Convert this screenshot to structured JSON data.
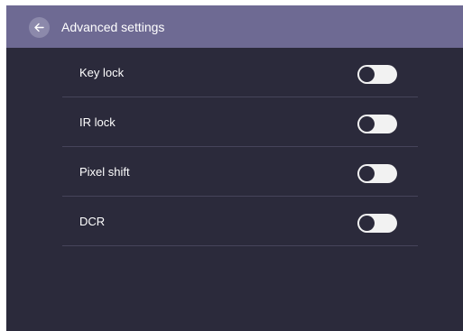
{
  "header": {
    "back_icon": "arrow-left-icon",
    "title": "Advanced settings"
  },
  "settings": {
    "items": [
      {
        "label": "Key lock",
        "enabled": false
      },
      {
        "label": "IR lock",
        "enabled": false
      },
      {
        "label": "Pixel shift",
        "enabled": false
      },
      {
        "label": "DCR",
        "enabled": false
      }
    ]
  },
  "colors": {
    "background": "#2b2a3b",
    "header": "#6e6a93",
    "back_button": "#8c89ab",
    "toggle_track_off": "#f2f2f2",
    "divider": "#46445a"
  }
}
